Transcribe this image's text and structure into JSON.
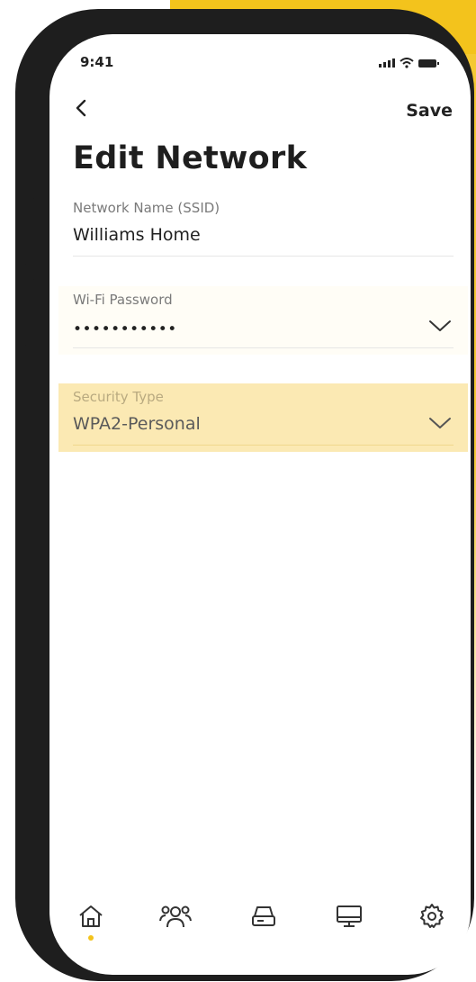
{
  "status_bar": {
    "time": "9:41"
  },
  "header": {
    "title": "Edit Network",
    "save_label": "Save",
    "back_icon": "chevron-left-icon"
  },
  "fields": {
    "ssid": {
      "label": "Network Name (SSID)",
      "value": "Williams Home"
    },
    "password": {
      "label": "Wi-Fi Password",
      "value": "•••••••••••",
      "icon": "chevron-down-icon"
    },
    "security": {
      "label": "Security Type",
      "value": "WPA2-Personal",
      "icon": "chevron-down-icon",
      "highlight_color": "#fbe9b3"
    }
  },
  "tabbar": {
    "items": [
      {
        "icon": "home-icon",
        "active": true
      },
      {
        "icon": "people-icon",
        "active": false
      },
      {
        "icon": "router-icon",
        "active": false
      },
      {
        "icon": "monitor-icon",
        "active": false
      },
      {
        "icon": "settings-gear-icon",
        "active": false
      }
    ],
    "active_indicator_color": "#f3c31c"
  },
  "colors": {
    "accent": "#f3c31c",
    "frame": "#1e1e1e"
  }
}
